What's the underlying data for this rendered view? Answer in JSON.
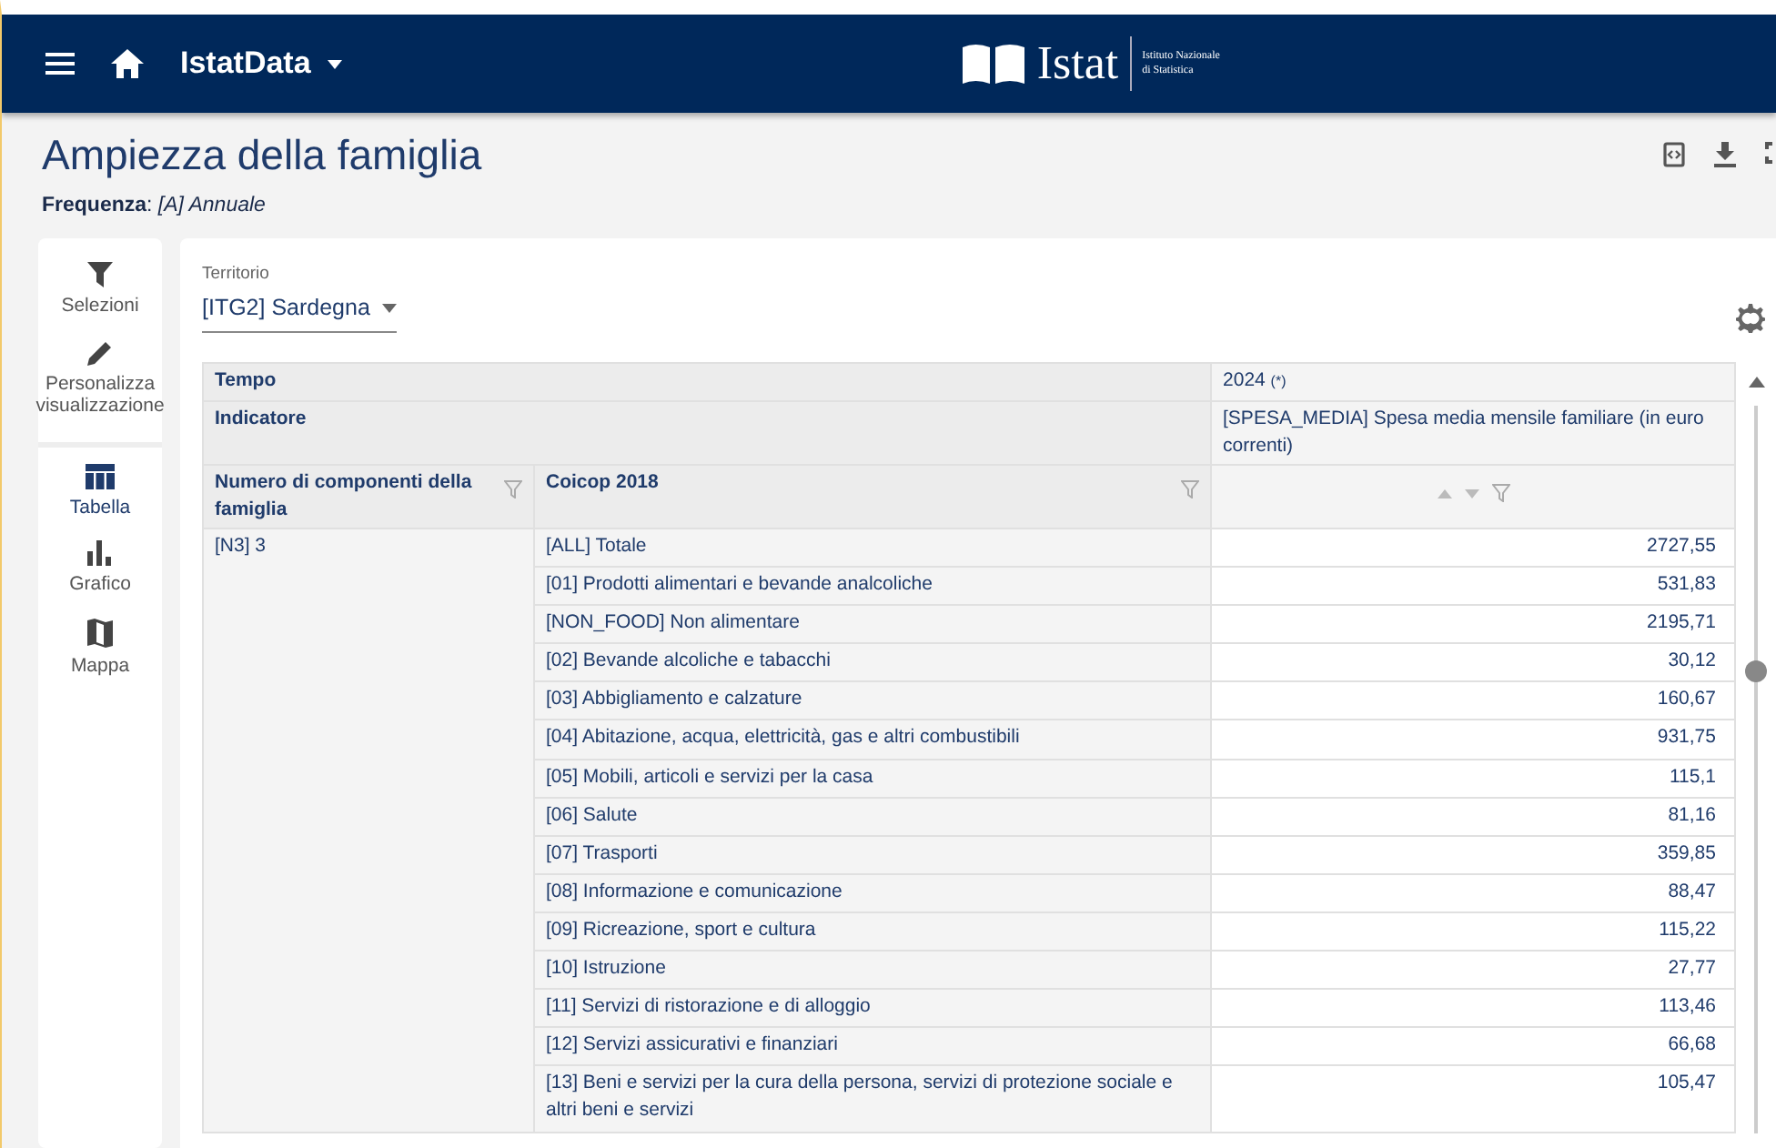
{
  "navbar": {
    "app_name": "IstatData",
    "logo_text": "Istat",
    "logo_subtitle": [
      "Istituto Nazionale",
      "di Statistica"
    ]
  },
  "page": {
    "title": "Ampiezza della famiglia",
    "frequency": "**Frequenza**: *[A] Annuale*"
  },
  "sidebar": {
    "items": [
      {
        "label": "Selezioni",
        "kind": "filter",
        "selected": false
      },
      {
        "label": "Personalizza visualizzazione",
        "kind": "edit",
        "selected": false
      },
      {
        "label": "Tabella",
        "kind": "table",
        "selected": true
      },
      {
        "label": "Grafico",
        "kind": "chart",
        "selected": false
      },
      {
        "label": "Mappa",
        "kind": "map",
        "selected": false
      }
    ]
  },
  "filter": {
    "label": "Territorio",
    "value": "[ITG2] Sardegna"
  },
  "table": {
    "time_label": "Tempo",
    "time_value": "2024",
    "time_note": "(*)",
    "indicator_label": "Indicatore",
    "indicator_value": "[SPESA_MEDIA] Spesa media mensile familiare (in euro correnti)",
    "columns": [
      "Numero di componenti della famiglia",
      "Coicop 2018"
    ],
    "group": "[N3] 3",
    "rows": [
      {
        "label": "[ALL] Totale",
        "value": "2727,55"
      },
      {
        "label": "[01] Prodotti alimentari e bevande analcoliche",
        "value": "531,83"
      },
      {
        "label": "[NON_FOOD] Non alimentare",
        "value": "2195,71"
      },
      {
        "label": "[02] Bevande alcoliche e tabacchi",
        "value": "30,12"
      },
      {
        "label": "[03] Abbigliamento e calzature",
        "value": "160,67"
      },
      {
        "label": "[04] Abitazione, acqua, elettricità, gas e altri combustibili",
        "value": "931,75"
      },
      {
        "label": "[05] Mobili, articoli e servizi per la casa",
        "value": "115,1"
      },
      {
        "label": "[06] Salute",
        "value": "81,16"
      },
      {
        "label": "[07] Trasporti",
        "value": "359,85"
      },
      {
        "label": "[08] Informazione e comunicazione",
        "value": "88,47"
      },
      {
        "label": "[09] Ricreazione, sport e cultura",
        "value": "115,22"
      },
      {
        "label": "[10] Istruzione",
        "value": "27,77"
      },
      {
        "label": "[11] Servizi di ristorazione e di alloggio",
        "value": "113,46"
      },
      {
        "label": "[12] Servizi assicurativi e finanziari",
        "value": "66,68"
      },
      {
        "label": "[13] Beni e servizi per la cura della persona, servizi di protezione sociale e altri beni e servizi",
        "value": "105,47"
      }
    ]
  }
}
